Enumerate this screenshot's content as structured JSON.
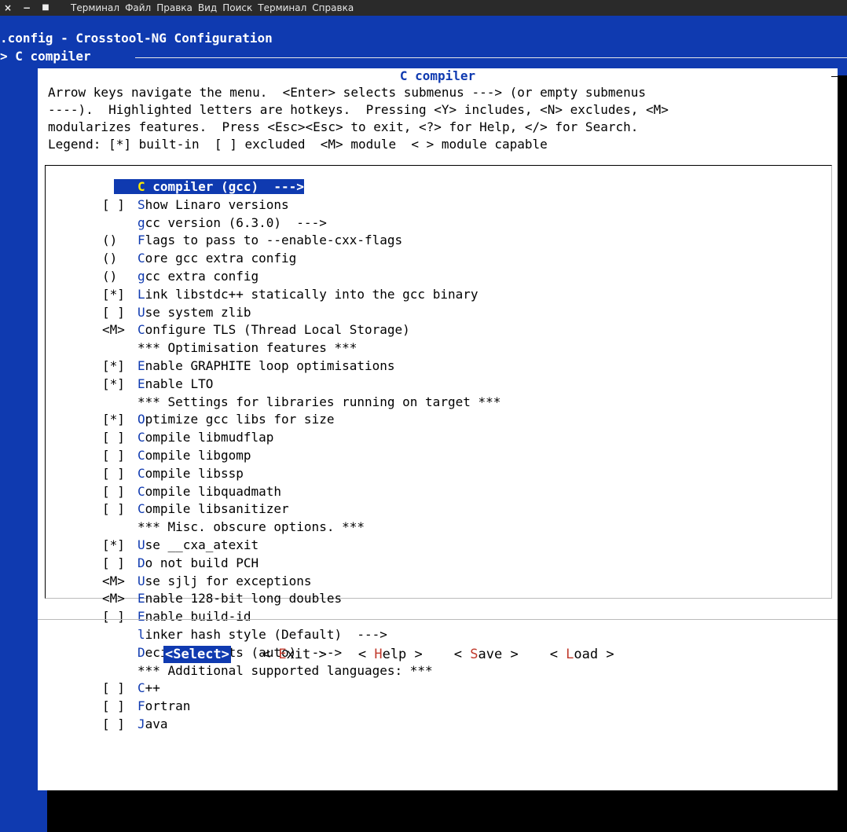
{
  "window": {
    "controls": [
      "×",
      "−",
      "■"
    ],
    "menu": [
      "Терминал",
      "Файл",
      "Правка",
      "Вид",
      "Поиск",
      "Терминал",
      "Справка"
    ]
  },
  "header": {
    "title": ".config - Crosstool-NG Configuration",
    "breadcrumb": "> C compiler"
  },
  "dialog": {
    "title": "C compiler",
    "help": [
      "Arrow keys navigate the menu.  <Enter> selects submenus ---> (or empty submenus",
      "----).  Highlighted letters are hotkeys.  Pressing <Y> includes, <N> excludes, <M>",
      "modularizes features.  Press <Esc><Esc> to exit, <?> for Help, </> for Search.",
      "Legend: [*] built-in  [ ] excluded  <M> module  < > module capable"
    ],
    "items": [
      {
        "prefix": "",
        "hotkey": "C",
        "rest": " compiler (gcc)  --->",
        "selected": true
      },
      {
        "prefix": "[ ]",
        "hotkey": "S",
        "rest": "how Linaro versions"
      },
      {
        "prefix": "",
        "hotkey": "g",
        "rest": "cc version (6.3.0)  --->"
      },
      {
        "prefix": "()",
        "hotkey": "F",
        "rest": "lags to pass to --enable-cxx-flags"
      },
      {
        "prefix": "()",
        "hotkey": "C",
        "rest": "ore gcc extra config"
      },
      {
        "prefix": "()",
        "hotkey": "g",
        "rest": "cc extra config"
      },
      {
        "prefix": "[*]",
        "hotkey": "L",
        "rest": "ink libstdc++ statically into the gcc binary"
      },
      {
        "prefix": "[ ]",
        "hotkey": "U",
        "rest": "se system zlib"
      },
      {
        "prefix": "<M>",
        "hotkey": "C",
        "rest": "onfigure TLS (Thread Local Storage)"
      },
      {
        "prefix": "",
        "hotkey": "",
        "rest": "*** Optimisation features ***"
      },
      {
        "prefix": "[*]",
        "hotkey": "E",
        "rest": "nable GRAPHITE loop optimisations"
      },
      {
        "prefix": "[*]",
        "hotkey": "E",
        "rest": "nable LTO"
      },
      {
        "prefix": "",
        "hotkey": "",
        "rest": "*** Settings for libraries running on target ***"
      },
      {
        "prefix": "[*]",
        "hotkey": "O",
        "rest": "ptimize gcc libs for size"
      },
      {
        "prefix": "[ ]",
        "hotkey": "C",
        "rest": "ompile libmudflap"
      },
      {
        "prefix": "[ ]",
        "hotkey": "C",
        "rest": "ompile libgomp"
      },
      {
        "prefix": "[ ]",
        "hotkey": "C",
        "rest": "ompile libssp"
      },
      {
        "prefix": "[ ]",
        "hotkey": "C",
        "rest": "ompile libquadmath"
      },
      {
        "prefix": "[ ]",
        "hotkey": "C",
        "rest": "ompile libsanitizer"
      },
      {
        "prefix": "",
        "hotkey": "",
        "rest": "*** Misc. obscure options. ***"
      },
      {
        "prefix": "[*]",
        "hotkey": "U",
        "rest": "se __cxa_atexit"
      },
      {
        "prefix": "[ ]",
        "hotkey": "D",
        "rest": "o not build PCH"
      },
      {
        "prefix": "<M>",
        "hotkey": "U",
        "rest": "se sjlj for exceptions"
      },
      {
        "prefix": "<M>",
        "hotkey": "E",
        "rest": "nable 128-bit long doubles"
      },
      {
        "prefix": "[ ]",
        "hotkey": "E",
        "rest": "nable build-id"
      },
      {
        "prefix": "",
        "hotkey": "l",
        "rest": "inker hash style (Default)  --->"
      },
      {
        "prefix": "",
        "hotkey": "D",
        "rest": "ecimal floats (auto)  --->"
      },
      {
        "prefix": "",
        "hotkey": "",
        "rest": "*** Additional supported languages: ***"
      },
      {
        "prefix": "[ ]",
        "hotkey": "C",
        "rest": "++"
      },
      {
        "prefix": "[ ]",
        "hotkey": "F",
        "rest": "ortran"
      },
      {
        "prefix": "[ ]",
        "hotkey": "J",
        "rest": "ava"
      }
    ],
    "buttons": [
      {
        "pre": "<",
        "hotkey": "S",
        "rest": "elect>",
        "active": true
      },
      {
        "pre": "< ",
        "hotkey": "E",
        "rest": "xit >",
        "active": false
      },
      {
        "pre": "< ",
        "hotkey": "H",
        "rest": "elp >",
        "active": false
      },
      {
        "pre": "< ",
        "hotkey": "S",
        "rest": "ave >",
        "active": false
      },
      {
        "pre": "< ",
        "hotkey": "L",
        "rest": "oad >",
        "active": false
      }
    ]
  },
  "colors": {
    "background": "#0f3ab0",
    "hotkey": "#0f3ab0",
    "button_hotkey": "#c0392b"
  }
}
